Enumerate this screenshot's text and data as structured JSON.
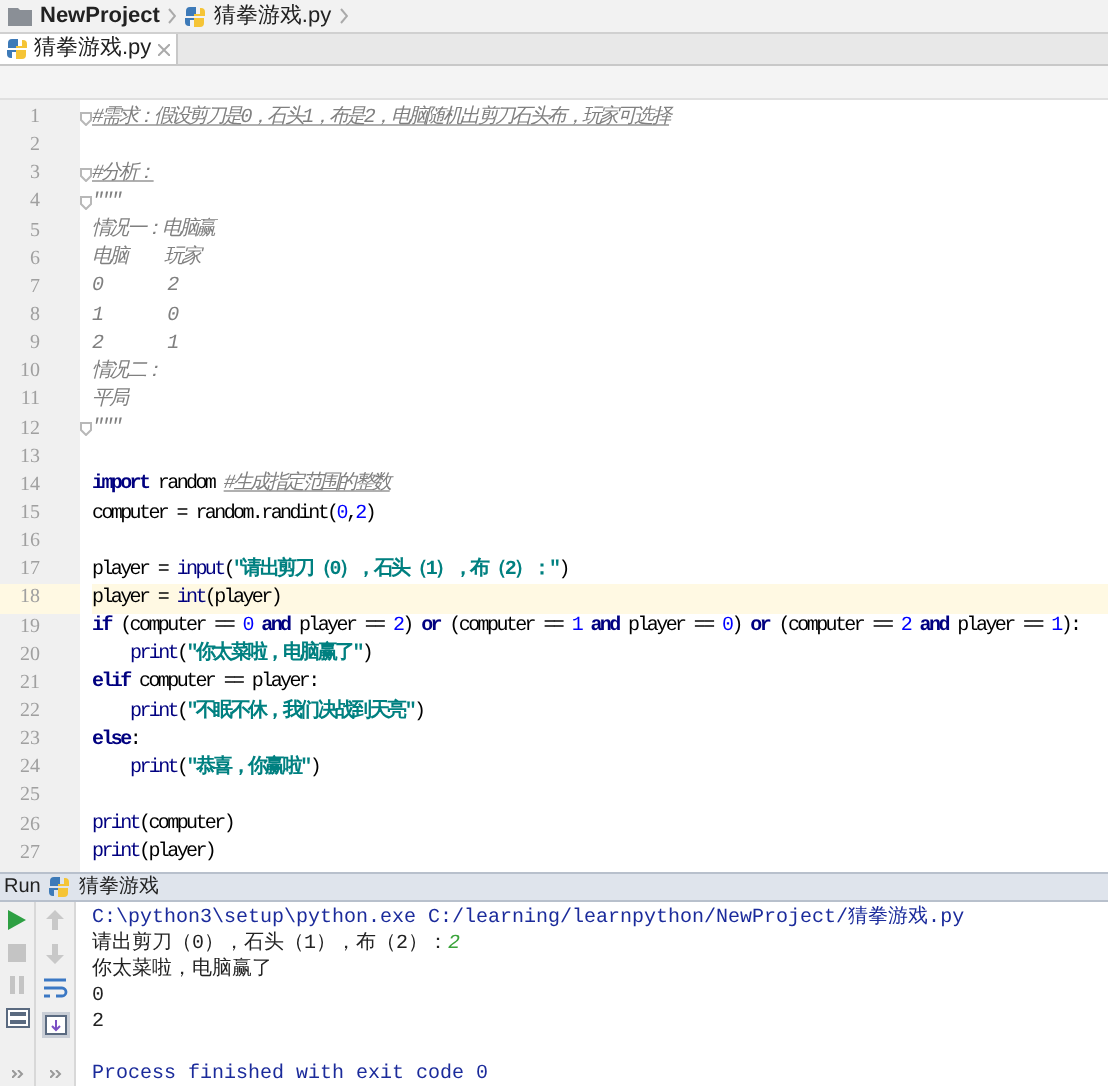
{
  "breadcrumbs": [
    {
      "kind": "folder",
      "label": "NewProject"
    },
    {
      "kind": "python",
      "label": "猜拳游戏.py"
    }
  ],
  "tabs": [
    {
      "label": "猜拳游戏.py",
      "selected": true
    }
  ],
  "editor": {
    "lines": [
      {
        "number": "1",
        "fold": true,
        "current": false,
        "tokens": [
          {
            "kind": "comment",
            "text": "#需求：假设剪刀是0，石头1，布是2，电脑随机出剪刀石头布，玩家可选择"
          }
        ]
      },
      {
        "number": "2",
        "fold": false,
        "current": false
      },
      {
        "number": "3",
        "fold": true,
        "current": false,
        "tokens": [
          {
            "kind": "comment",
            "text": "#分析："
          }
        ]
      },
      {
        "number": "4",
        "fold": true,
        "current": false,
        "tokens": [
          {
            "kind": "docstring",
            "text": "\"\"\""
          }
        ]
      },
      {
        "number": "5",
        "fold": false,
        "current": false,
        "tokens": [
          {
            "kind": "docstring",
            "text": "情况一：电脑赢"
          }
        ]
      },
      {
        "number": "6",
        "fold": false,
        "current": false,
        "tokens": [
          {
            "kind": "docstring",
            "text": "电脑    玩家"
          }
        ]
      },
      {
        "number": "7",
        "fold": false,
        "current": false,
        "tokens": [
          {
            "kind": "docstring",
            "text": "0       2"
          }
        ]
      },
      {
        "number": "8",
        "fold": false,
        "current": false,
        "tokens": [
          {
            "kind": "docstring",
            "text": "1       0"
          }
        ]
      },
      {
        "number": "9",
        "fold": false,
        "current": false,
        "tokens": [
          {
            "kind": "docstring",
            "text": "2       1"
          }
        ]
      },
      {
        "number": "10",
        "fold": false,
        "current": false,
        "tokens": [
          {
            "kind": "docstring",
            "text": "情况二："
          }
        ]
      },
      {
        "number": "11",
        "fold": false,
        "current": false,
        "tokens": [
          {
            "kind": "docstring",
            "text": "平局"
          }
        ]
      },
      {
        "number": "12",
        "fold": true,
        "current": false,
        "tokens": [
          {
            "kind": "docstring",
            "text": "\"\"\""
          }
        ]
      },
      {
        "number": "13",
        "fold": false,
        "current": false
      },
      {
        "number": "14",
        "fold": false,
        "current": false,
        "tokens": [
          {
            "kind": "keyword",
            "text": "import"
          },
          {
            "kind": "plain",
            "text": " random "
          },
          {
            "kind": "comment",
            "text": "#生成指定范围的整数"
          }
        ]
      },
      {
        "number": "15",
        "fold": false,
        "current": false,
        "tokens": [
          {
            "kind": "plain",
            "text": "computer = random.randint("
          },
          {
            "kind": "number",
            "text": "0"
          },
          {
            "kind": "plain",
            "text": ","
          },
          {
            "kind": "number",
            "text": "2"
          },
          {
            "kind": "plain",
            "text": ")"
          }
        ]
      },
      {
        "number": "16",
        "fold": false,
        "current": false
      },
      {
        "number": "17",
        "fold": false,
        "current": false,
        "tokens": [
          {
            "kind": "plain",
            "text": "player = "
          },
          {
            "kind": "builtin",
            "text": "input"
          },
          {
            "kind": "plain",
            "text": "("
          },
          {
            "kind": "string",
            "text": "\"请出剪刀（0），石头（1），布（2）：\""
          },
          {
            "kind": "plain",
            "text": ")"
          }
        ]
      },
      {
        "number": "18",
        "fold": false,
        "current": true,
        "tokens": [
          {
            "kind": "plain",
            "text": "player = "
          },
          {
            "kind": "builtin",
            "text": "int"
          },
          {
            "kind": "plain",
            "text": "(player)"
          }
        ]
      },
      {
        "number": "19",
        "fold": false,
        "current": false,
        "tokens": [
          {
            "kind": "keyword",
            "text": "if"
          },
          {
            "kind": "plain",
            "text": " (computer == "
          },
          {
            "kind": "number",
            "text": "0"
          },
          {
            "kind": "keyword",
            "text": " and"
          },
          {
            "kind": "plain",
            "text": " player == "
          },
          {
            "kind": "number",
            "text": "2"
          },
          {
            "kind": "plain",
            "text": ") "
          },
          {
            "kind": "keyword",
            "text": "or"
          },
          {
            "kind": "plain",
            "text": " (computer == "
          },
          {
            "kind": "number",
            "text": "1"
          },
          {
            "kind": "keyword",
            "text": " and"
          },
          {
            "kind": "plain",
            "text": " player == "
          },
          {
            "kind": "number",
            "text": "0"
          },
          {
            "kind": "plain",
            "text": ") "
          },
          {
            "kind": "keyword",
            "text": "or"
          },
          {
            "kind": "plain",
            "text": " (computer == "
          },
          {
            "kind": "number",
            "text": "2"
          },
          {
            "kind": "keyword",
            "text": " and"
          },
          {
            "kind": "plain",
            "text": " player == "
          },
          {
            "kind": "number",
            "text": "1"
          },
          {
            "kind": "plain",
            "text": "):"
          }
        ]
      },
      {
        "number": "20",
        "fold": false,
        "current": false,
        "indent": true,
        "tokens": [
          {
            "kind": "builtin",
            "text": "print"
          },
          {
            "kind": "plain",
            "text": "("
          },
          {
            "kind": "string",
            "text": "\"你太菜啦，电脑赢了\""
          },
          {
            "kind": "plain",
            "text": ")"
          }
        ]
      },
      {
        "number": "21",
        "fold": false,
        "current": false,
        "tokens": [
          {
            "kind": "keyword",
            "text": "elif"
          },
          {
            "kind": "plain",
            "text": " computer == player:"
          }
        ]
      },
      {
        "number": "22",
        "fold": false,
        "current": false,
        "indent": true,
        "tokens": [
          {
            "kind": "builtin",
            "text": "print"
          },
          {
            "kind": "plain",
            "text": "("
          },
          {
            "kind": "string",
            "text": "\"不眠不休，我们决战到天亮\""
          },
          {
            "kind": "plain",
            "text": ")"
          }
        ]
      },
      {
        "number": "23",
        "fold": false,
        "current": false,
        "tokens": [
          {
            "kind": "keyword",
            "text": "else"
          },
          {
            "kind": "plain",
            "text": ":"
          }
        ]
      },
      {
        "number": "24",
        "fold": false,
        "current": false,
        "indent": true,
        "tokens": [
          {
            "kind": "builtin",
            "text": "print"
          },
          {
            "kind": "plain",
            "text": "("
          },
          {
            "kind": "string",
            "text": "\"恭喜，你赢啦\""
          },
          {
            "kind": "plain",
            "text": ")"
          }
        ]
      },
      {
        "number": "25",
        "fold": false,
        "current": false
      },
      {
        "number": "26",
        "fold": false,
        "current": false,
        "tokens": [
          {
            "kind": "builtin",
            "text": "print"
          },
          {
            "kind": "plain",
            "text": "(computer)"
          }
        ]
      },
      {
        "number": "27",
        "fold": false,
        "current": false,
        "tokens": [
          {
            "kind": "builtin",
            "text": "print"
          },
          {
            "kind": "plain",
            "text": "(player)"
          }
        ]
      }
    ]
  },
  "run_panel": {
    "label": "Run",
    "config": "猜拳游戏",
    "console": [
      {
        "kind": "command",
        "text": "C:\\python3\\setup\\python.exe C:/learning/learnpython/NewProject/猜拳游戏.py"
      },
      {
        "kind": "prompt",
        "text": "请出剪刀（0），石头（1），布（2）：",
        "input": "2"
      },
      {
        "kind": "output",
        "text": "你太菜啦，电脑赢了"
      },
      {
        "kind": "output",
        "text": "0"
      },
      {
        "kind": "output",
        "text": "2"
      },
      {
        "kind": "exit",
        "text": "Process finished with exit code 0"
      }
    ]
  }
}
